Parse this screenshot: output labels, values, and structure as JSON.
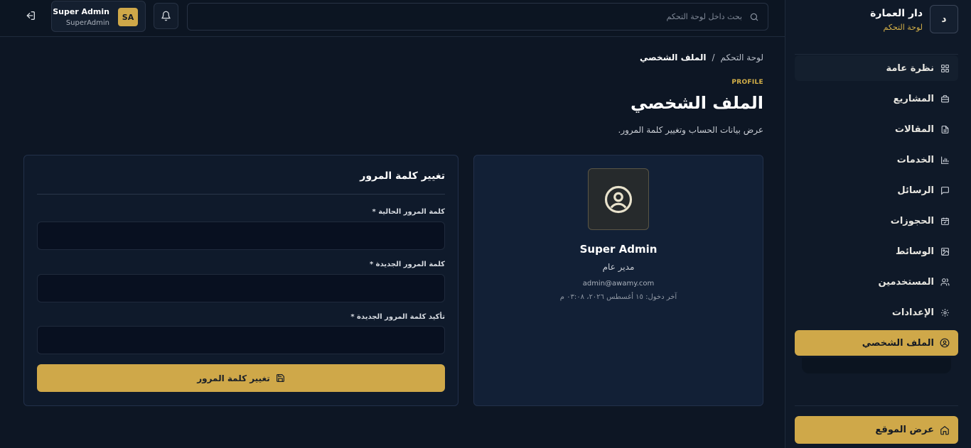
{
  "brand": {
    "logo_letter": "د",
    "name": "دار العمارة",
    "subtitle": "لوحة التحكم"
  },
  "nav": {
    "items": [
      {
        "label": "نظرة عامة",
        "icon": "grid-icon"
      },
      {
        "label": "المشاريع",
        "icon": "briefcase-icon"
      },
      {
        "label": "المقالات",
        "icon": "document-icon"
      },
      {
        "label": "الخدمات",
        "icon": "bar-chart-icon"
      },
      {
        "label": "الرسائل",
        "icon": "message-icon"
      },
      {
        "label": "الحجوزات",
        "icon": "calendar-icon"
      },
      {
        "label": "الوسائط",
        "icon": "image-icon"
      },
      {
        "label": "المستخدمين",
        "icon": "users-icon"
      },
      {
        "label": "الإعدادات",
        "icon": "gear-icon"
      },
      {
        "label": "الملف الشخصي",
        "icon": "user-circle-icon"
      }
    ],
    "view_site": "عرض الموقع"
  },
  "topbar": {
    "search_placeholder": "بحث داخل لوحة التحكم",
    "user_initials": "SA",
    "user_name": "Super Admin",
    "user_role": "SuperAdmin"
  },
  "breadcrumb": {
    "root": "لوحة التحكم",
    "separator": "/",
    "current": "الملف الشخصي"
  },
  "page": {
    "eyebrow": "PROFILE",
    "title": "الملف الشخصي",
    "subtitle": "عرض بيانات الحساب وتغيير كلمة المرور."
  },
  "profile": {
    "name": "Super Admin",
    "role": "مدير عام",
    "email": "admin@awamy.com",
    "last_login": "آخر دخول: ١٥ أغسطس ٢٠٢٦، ٠٣:٠٨ م"
  },
  "password_form": {
    "title": "تغيير كلمة المرور",
    "current_label": "كلمة المرور الحالية *",
    "new_label": "كلمة المرور الجديدة *",
    "confirm_label": "تأكيد كلمة المرور الجديدة *",
    "submit_label": "تغيير كلمة المرور"
  },
  "colors": {
    "accent": "#cfa849",
    "background": "#0d1624",
    "card": "#122036"
  }
}
